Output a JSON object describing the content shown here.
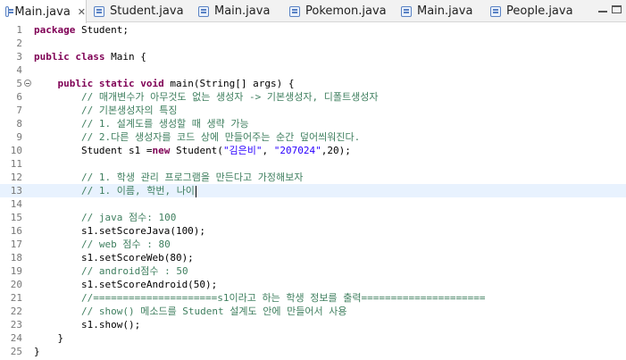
{
  "tabs": [
    {
      "label": "Main.java",
      "active": true,
      "close": "✕"
    },
    {
      "label": "Student.java",
      "active": false
    },
    {
      "label": "Main.java",
      "active": false
    },
    {
      "label": "Pokemon.java",
      "active": false
    },
    {
      "label": "Main.java",
      "active": false
    },
    {
      "label": "People.java",
      "active": false
    }
  ],
  "editor": {
    "lines": [
      {
        "n": "1",
        "segments": [
          {
            "t": "package",
            "c": "kw"
          },
          {
            "t": " Student;"
          }
        ]
      },
      {
        "n": "2",
        "segments": []
      },
      {
        "n": "3",
        "segments": [
          {
            "t": "public",
            "c": "kw"
          },
          {
            "t": " "
          },
          {
            "t": "class",
            "c": "kw"
          },
          {
            "t": " Main {"
          }
        ]
      },
      {
        "n": "4",
        "segments": []
      },
      {
        "n": "5",
        "fold": true,
        "segments": [
          {
            "t": "    "
          },
          {
            "t": "public",
            "c": "kw"
          },
          {
            "t": " "
          },
          {
            "t": "static",
            "c": "kw"
          },
          {
            "t": " "
          },
          {
            "t": "void",
            "c": "kw"
          },
          {
            "t": " main(String[] args) {"
          }
        ]
      },
      {
        "n": "6",
        "segments": [
          {
            "t": "        "
          },
          {
            "t": "// 매개변수가 아무것도 없는 생성자 -> 기본생성자, 디폴트생성자",
            "c": "cm"
          }
        ]
      },
      {
        "n": "7",
        "segments": [
          {
            "t": "        "
          },
          {
            "t": "// 기본생성자의 특징",
            "c": "cm"
          }
        ]
      },
      {
        "n": "8",
        "segments": [
          {
            "t": "        "
          },
          {
            "t": "// 1. 설계도를 생성할 때 생략 가능",
            "c": "cm"
          }
        ]
      },
      {
        "n": "9",
        "segments": [
          {
            "t": "        "
          },
          {
            "t": "// 2.다른 생성자를 코드 상에 만들어주는 순간 덮어씌워진다.",
            "c": "cm"
          }
        ]
      },
      {
        "n": "10",
        "segments": [
          {
            "t": "        Student s1 ="
          },
          {
            "t": "new",
            "c": "kw"
          },
          {
            "t": " Student("
          },
          {
            "t": "\"김은비\"",
            "c": "str"
          },
          {
            "t": ", "
          },
          {
            "t": "\"207024\"",
            "c": "str"
          },
          {
            "t": ",20);"
          }
        ]
      },
      {
        "n": "11",
        "segments": []
      },
      {
        "n": "12",
        "segments": [
          {
            "t": "        "
          },
          {
            "t": "// 1. 학생 관리 프로그램을 만든다고 가정해보자",
            "c": "cm"
          }
        ]
      },
      {
        "n": "13",
        "current": true,
        "caret": true,
        "segments": [
          {
            "t": "        "
          },
          {
            "t": "// 1. 이름, 학번, 나이",
            "c": "cm"
          }
        ]
      },
      {
        "n": "14",
        "segments": []
      },
      {
        "n": "15",
        "segments": [
          {
            "t": "        "
          },
          {
            "t": "// java 점수: 100",
            "c": "cm"
          }
        ]
      },
      {
        "n": "16",
        "segments": [
          {
            "t": "        s1.setScoreJava(100);"
          }
        ]
      },
      {
        "n": "17",
        "segments": [
          {
            "t": "        "
          },
          {
            "t": "// web 점수 : 80",
            "c": "cm"
          }
        ]
      },
      {
        "n": "18",
        "segments": [
          {
            "t": "        s1.setScoreWeb(80);"
          }
        ]
      },
      {
        "n": "19",
        "segments": [
          {
            "t": "        "
          },
          {
            "t": "// android점수 : 50",
            "c": "cm"
          }
        ]
      },
      {
        "n": "20",
        "segments": [
          {
            "t": "        s1.setScoreAndroid(50);"
          }
        ]
      },
      {
        "n": "21",
        "segments": [
          {
            "t": "        "
          },
          {
            "t": "//=====================s1이라고 하는 학생 정보를 출력=====================",
            "c": "cm"
          }
        ]
      },
      {
        "n": "22",
        "segments": [
          {
            "t": "        "
          },
          {
            "t": "// show() 메소드를 Student 설계도 안에 만들어서 사용",
            "c": "cm"
          }
        ]
      },
      {
        "n": "23",
        "segments": [
          {
            "t": "        s1.show();"
          }
        ]
      },
      {
        "n": "24",
        "segments": [
          {
            "t": "    }"
          }
        ]
      },
      {
        "n": "25",
        "segments": [
          {
            "t": "}"
          }
        ]
      }
    ]
  },
  "window_controls": [
    "minimize-icon",
    "maximize-icon"
  ]
}
